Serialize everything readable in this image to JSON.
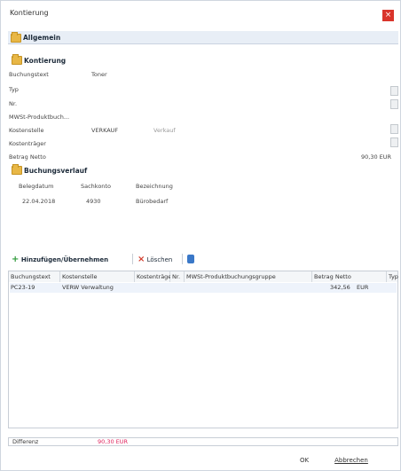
{
  "window": {
    "title": "Kontierung"
  },
  "tabs": {
    "allgemein": "Allgemein"
  },
  "kontierung": {
    "header": "Kontierung",
    "buchungstext_label": "Buchungstext",
    "buchungstext_value": "Toner",
    "typ_label": "Typ",
    "nr_label": "Nr.",
    "mwst_label": "MWSt-Produktbuch...",
    "kostenstelle_label": "Kostenstelle",
    "kostenstelle_code": "VERKAUF",
    "kostenstelle_name": "Verkauf",
    "kostentraeger_label": "Kostenträger",
    "betrag_label": "Betrag Netto",
    "betrag_value": "90,30 EUR"
  },
  "buchungsverlauf": {
    "header": "Buchungsverlauf",
    "columns": [
      "Belegdatum",
      "Sachkonto",
      "Bezeichnung"
    ],
    "rows": [
      {
        "belegdatum": "22.04.2018",
        "sachkonto": "4930",
        "bezeichnung": "Bürobedarf"
      }
    ]
  },
  "toolbar": {
    "add_label": "Hinzufügen/Übernehmen",
    "delete_label": "Löschen"
  },
  "grid": {
    "columns": [
      "Buchungstext",
      "Kostenstelle",
      "Kostenträger",
      "Nr.",
      "MWSt-Produktbuchungsgruppe",
      "Betrag Netto",
      "Typ"
    ],
    "rows": [
      {
        "buchungstext": "PC23-19",
        "kostenstelle": "VERW Verwaltung",
        "betrag": "342,56",
        "waehrung": "EUR"
      }
    ]
  },
  "footer": {
    "differenz_label": "Differenz",
    "differenz_value": "90,30 EUR",
    "ok_label": "OK",
    "cancel_label": "Abbrechen"
  },
  "colors": {
    "accent": "#d9342b",
    "difference": "#e0245e",
    "section_bg": "#e8eef6"
  }
}
